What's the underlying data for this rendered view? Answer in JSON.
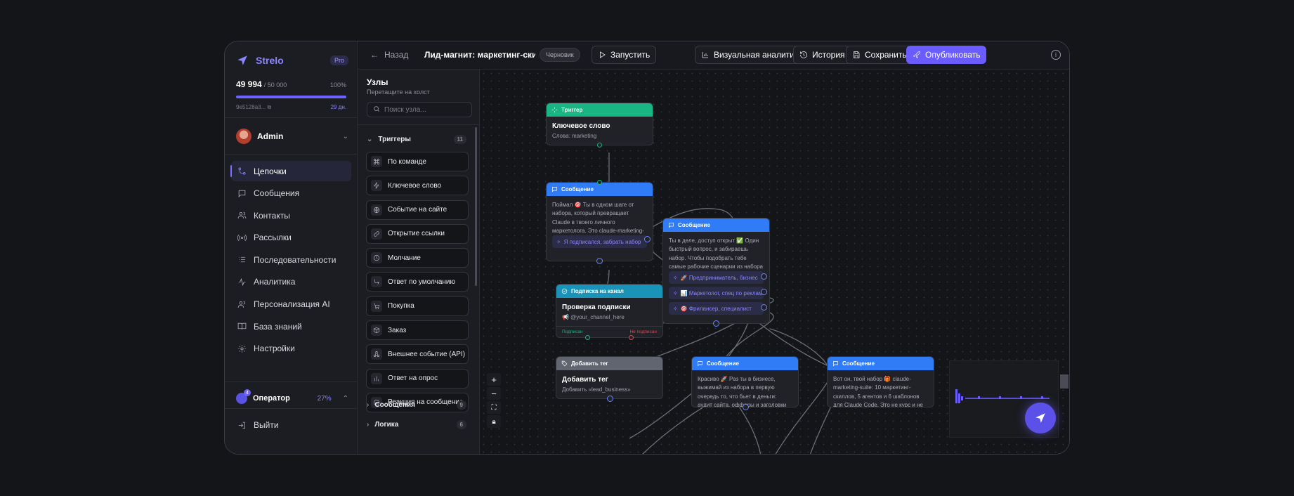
{
  "brand": {
    "name": "Strelo",
    "plan": "Pro"
  },
  "quota": {
    "used": "49 994",
    "total": "/ 50 000",
    "percent_label": "100%",
    "percent": 100,
    "id": "9e5128a3...",
    "days": "29 дн."
  },
  "user": {
    "name": "Admin"
  },
  "nav": [
    {
      "label": "Цепочки",
      "icon": "workflow-icon",
      "active": true
    },
    {
      "label": "Сообщения",
      "icon": "message-icon"
    },
    {
      "label": "Контакты",
      "icon": "contacts-icon"
    },
    {
      "label": "Рассылки",
      "icon": "broadcast-icon"
    },
    {
      "label": "Последовательности",
      "icon": "sequence-icon"
    },
    {
      "label": "Аналитика",
      "icon": "analytics-icon"
    },
    {
      "label": "Персонализация AI",
      "icon": "ai-users-icon"
    },
    {
      "label": "База знаний",
      "icon": "book-icon"
    },
    {
      "label": "Настройки",
      "icon": "gear-icon"
    }
  ],
  "operator": {
    "name": "Оператор",
    "percent": "27%",
    "badge": "4"
  },
  "logout": "Выйти",
  "topbar": {
    "back": "Назад",
    "title": "Лид-магнит: маркетинг-скиллы",
    "status": "Черновик",
    "run": "Запустить",
    "analytics": "Визуальная аналитика",
    "history": "История",
    "save": "Сохранить",
    "publish": "Опубликовать"
  },
  "library": {
    "title": "Узлы",
    "subtitle": "Перетащите на холст",
    "search_placeholder": "Поиск узла...",
    "categories": [
      {
        "label": "Триггеры",
        "count": "11"
      },
      {
        "label": "Сообщения",
        "count": "9"
      },
      {
        "label": "Логика",
        "count": "6"
      }
    ],
    "items": [
      {
        "label": "По команде",
        "icon": "command-icon"
      },
      {
        "label": "Ключевое слово",
        "icon": "bolt-icon"
      },
      {
        "label": "Событие на сайте",
        "icon": "globe-icon"
      },
      {
        "label": "Открытие ссылки",
        "icon": "link-icon"
      },
      {
        "label": "Молчание",
        "icon": "clock-icon"
      },
      {
        "label": "Ответ по умолчанию",
        "icon": "reply-icon"
      },
      {
        "label": "Покупка",
        "icon": "cart-icon"
      },
      {
        "label": "Заказ",
        "icon": "box-icon"
      },
      {
        "label": "Внешнее событие (API)",
        "icon": "webhook-icon"
      },
      {
        "label": "Ответ на опрос",
        "icon": "poll-icon"
      },
      {
        "label": "Реакция на сообщение",
        "icon": "smile-icon"
      }
    ]
  },
  "canvas": {
    "zoom_in": "+",
    "zoom_out": "−",
    "trigger": {
      "type": "Триггер",
      "title": "Ключевое слово",
      "sub": "Слова: marketing"
    },
    "msg1": {
      "type": "Сообщение",
      "text": "Поймал 🎯 Ты в одном шаге от набора, который превращает Claude в твоего личного маркетолога. Это claude-marketing-suite",
      "button": "Я подписался, забрать набор"
    },
    "msg2": {
      "type": "Сообщение",
      "text": "Ты в деле, доступ открыт ✅ Один быстрый вопрос, и забираешь набор. Чтобы подобрать тебе самые рабочие сценарии из набора",
      "buttons": [
        "🚀 Предприниматель, бизнес",
        "📊 Маркетолог, спец по рекламе",
        "🎯 Фрилансер, специалист"
      ]
    },
    "sub": {
      "type": "Подписка на канал",
      "title": "Проверка подписки",
      "sub": "📢 @your_channel_here",
      "yes": "Подписан",
      "no": "Не подписан"
    },
    "tag": {
      "type": "Добавить тег",
      "title": "Добавить тег",
      "sub": "Добавить «lead_business»"
    },
    "msg3": {
      "type": "Сообщение",
      "text": "Красиво 🚀 Раз ты в бизнесе, выжимай из набора в первую очередь то, что бьет в деньги: аудит сайта, офферы и заголовки"
    },
    "msg4": {
      "type": "Сообщение",
      "text": "Вот он, твой набор 🎁 claude-marketing-suite: 10 маркетинг-скиллов, 5 агентов и 6 шаблонов для Claude Code. Это не курс и не"
    }
  },
  "colors": {
    "accent": "#6a5cff",
    "trigger": "#19b582",
    "message": "#2f7cf6",
    "subscription": "#1a93b8",
    "tag": "#61656f"
  }
}
